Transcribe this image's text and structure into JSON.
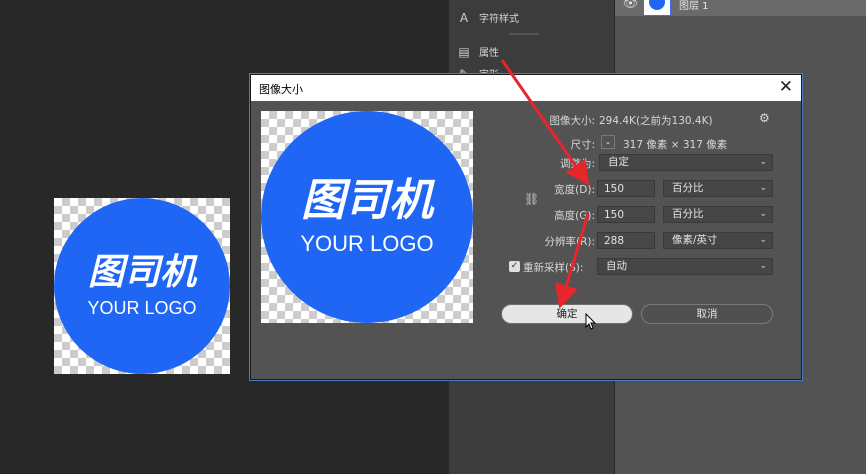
{
  "panel": {
    "char_style": "字符样式",
    "properties": "属性",
    "partial_item": "字形",
    "layer_name": "图层 1"
  },
  "logo": {
    "cn": "图司机",
    "en": "YOUR LOGO",
    "color": "#1f66f5"
  },
  "dialog": {
    "title": "图像大小",
    "close": "✕",
    "image_size_label": "图像大小:",
    "image_size_value": "294.4K(之前为130.4K)",
    "dimensions_label": "尺寸:",
    "dimensions_value": "317 像素  ×  317 像素",
    "fit_label": "调整为:",
    "fit_value": "自定",
    "width_label": "宽度(D):",
    "width_value": "150",
    "width_unit": "百分比",
    "height_label": "高度(G):",
    "height_value": "150",
    "height_unit": "百分比",
    "resolution_label": "分辨率(R):",
    "resolution_value": "288",
    "resolution_unit": "像素/英寸",
    "resample_label": "重新采样(S):",
    "resample_value": "自动",
    "ok": "确定",
    "cancel": "取消"
  },
  "colors": {
    "annotation_red": "#e8252a",
    "canvas_bg": "#282828",
    "dialog_bg": "#535353"
  }
}
